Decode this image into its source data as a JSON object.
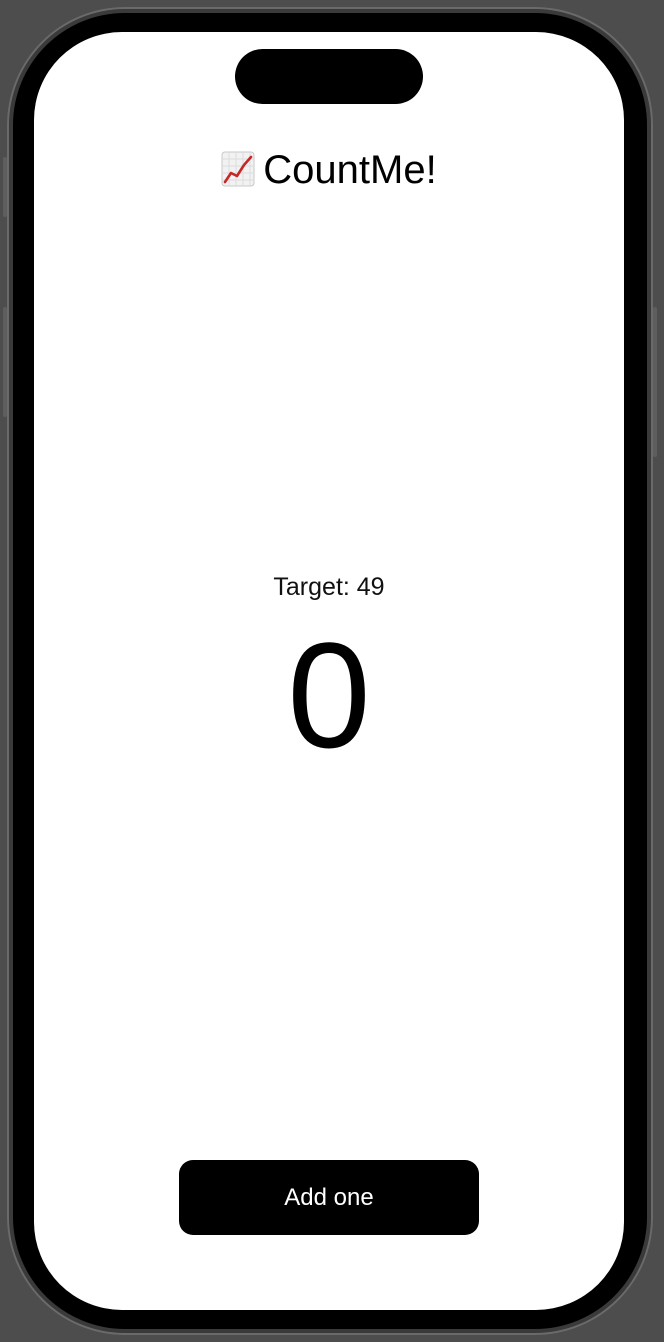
{
  "app": {
    "title": "CountMe!",
    "title_icon": "chart-increasing-icon"
  },
  "game": {
    "target_text": "Target: 49",
    "count": "0"
  },
  "actions": {
    "add_label": "Add one"
  },
  "colors": {
    "screen_background": "#ffffff",
    "button_background": "#000000",
    "button_text": "#ffffff",
    "device_frame": "#3a3a3a",
    "outer_background": "#4d4d4d"
  }
}
